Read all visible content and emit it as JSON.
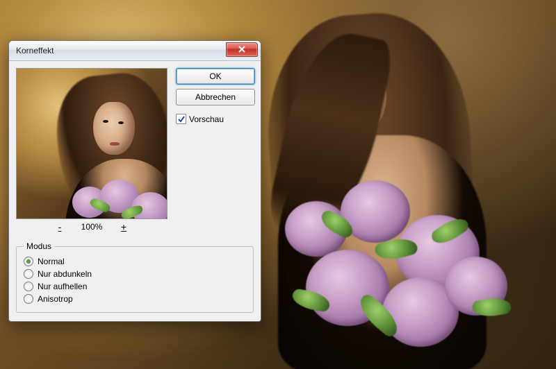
{
  "dialog": {
    "title": "Korneffekt",
    "ok_label": "OK",
    "cancel_label": "Abbrechen",
    "preview_checkbox_label": "Vorschau",
    "preview_checked": true,
    "zoom": {
      "minus": "-",
      "plus": "+",
      "value": "100%"
    },
    "modus": {
      "legend": "Modus",
      "options": [
        {
          "label": "Normal",
          "checked": true
        },
        {
          "label": "Nur abdunkeln",
          "checked": false
        },
        {
          "label": "Nur aufhellen",
          "checked": false
        },
        {
          "label": "Anisotrop",
          "checked": false
        }
      ]
    }
  }
}
